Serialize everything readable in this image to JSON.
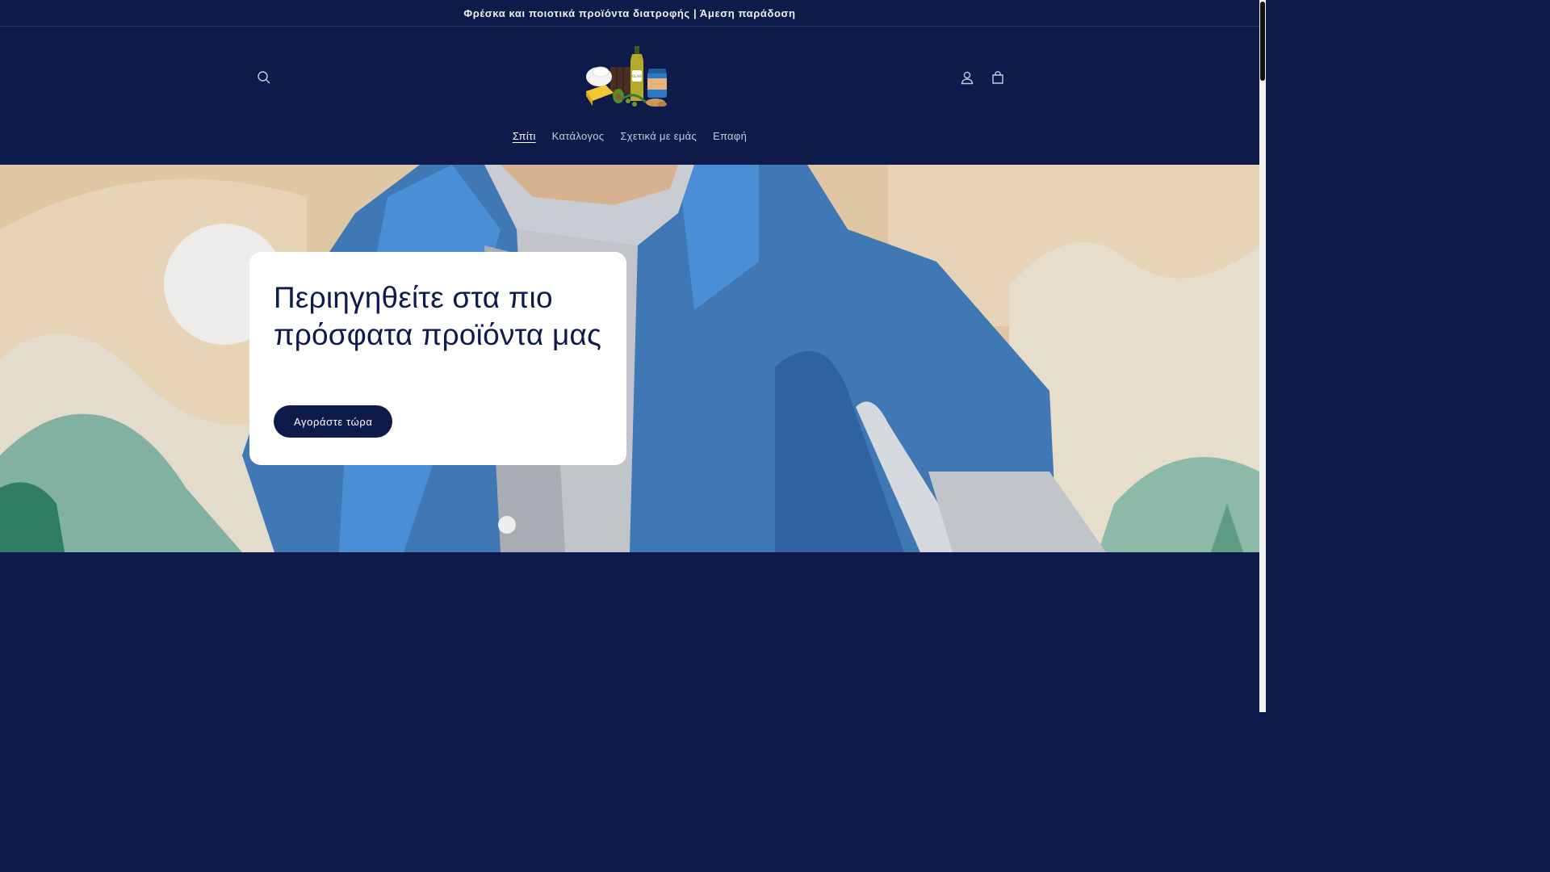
{
  "announcement": {
    "text": "Φρέσκα και ποιοτικά προϊόντα διατροφής | Άμεση παράδοση"
  },
  "header": {
    "search_icon": "search-icon",
    "account_icon": "user-icon",
    "cart_icon": "cart-icon"
  },
  "nav": {
    "items": [
      {
        "label": "Σπίτι",
        "active": true
      },
      {
        "label": "Κατάλογος"
      },
      {
        "label": "Σχετικά με εμάς"
      },
      {
        "label": "Επαφή"
      }
    ]
  },
  "hero": {
    "title": "Περιηγηθείτε στα πιο πρόσφατα προϊόντα μας",
    "cta_label": "Αγοράστε τώρα"
  },
  "colors": {
    "brand_navy": "#0e1a4a",
    "jacket_blue": "#3f78b5",
    "sand": "#dfc7a4"
  }
}
